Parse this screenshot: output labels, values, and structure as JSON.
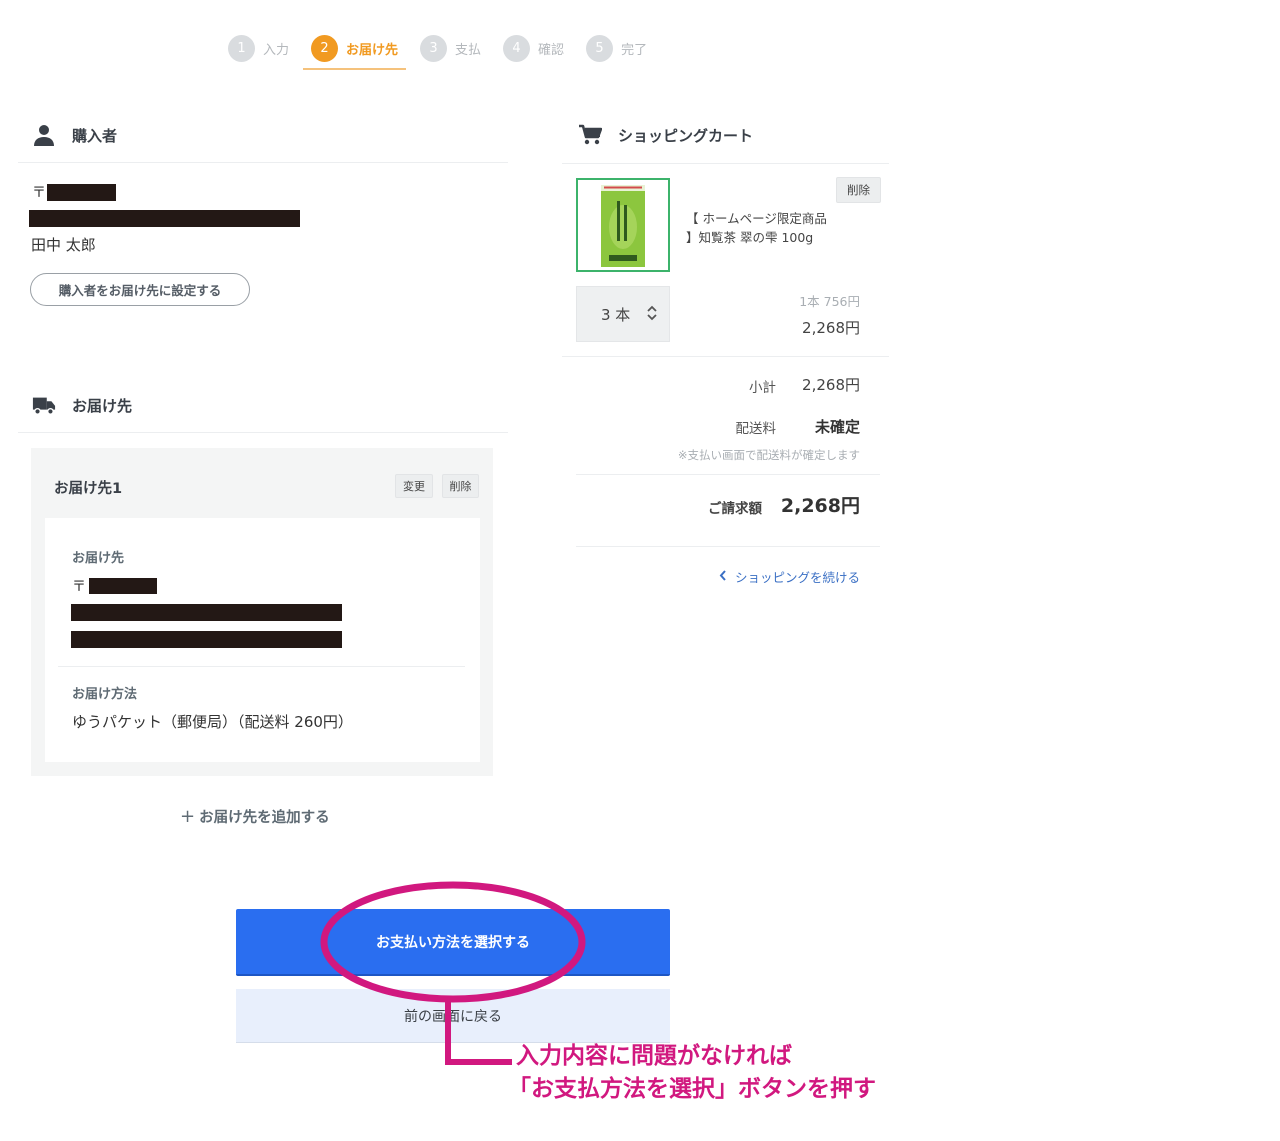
{
  "steps": [
    {
      "num": "1",
      "label": "入力",
      "active": false
    },
    {
      "num": "2",
      "label": "お届け先",
      "active": true
    },
    {
      "num": "3",
      "label": "支払",
      "active": false
    },
    {
      "num": "4",
      "label": "確認",
      "active": false
    },
    {
      "num": "5",
      "label": "完了",
      "active": false
    }
  ],
  "buyer": {
    "heading": "購入者",
    "postal_mark": "〒",
    "name": "田中 太郎",
    "set_as_destination_button": "購入者をお届け先に設定する"
  },
  "destination_section": {
    "heading": "お届け先",
    "card_title": "お届け先1",
    "change_button": "変更",
    "delete_button": "削除",
    "address_label": "お届け先",
    "postal_mark": "〒",
    "method_label": "お届け方法",
    "method_value": "ゆうパケット（郵便局）（配送料 260円）",
    "add_destination_link": "お届け先を追加する"
  },
  "cart": {
    "heading": "ショッピングカート",
    "item": {
      "delete_button": "削除",
      "name_line1": "【 ホームページ限定商品",
      "name_line2": "】知覧茶 翠の雫 100g",
      "quantity": "3 本",
      "unit_price": "1本 756円",
      "line_total": "2,268円"
    },
    "subtotal_label": "小計",
    "subtotal_value": "2,268円",
    "shipping_label": "配送料",
    "shipping_value": "未確定",
    "shipping_note": "※支払い画面で配送料が確定します",
    "total_label": "ご請求額",
    "total_value": "2,268円",
    "continue_link": "ショッピングを続ける"
  },
  "actions": {
    "primary": "お支払い方法を選択する",
    "secondary": "前の画面に戻る"
  },
  "annotation": {
    "line1": "入力内容に問題がなければ",
    "line2": "「お支払方法を選択」ボタンを押す",
    "color": "#d1187f"
  },
  "colors": {
    "accent_orange": "#f19a21",
    "primary_blue": "#2a6ef0",
    "thumb_border_green": "#3cb36b"
  }
}
